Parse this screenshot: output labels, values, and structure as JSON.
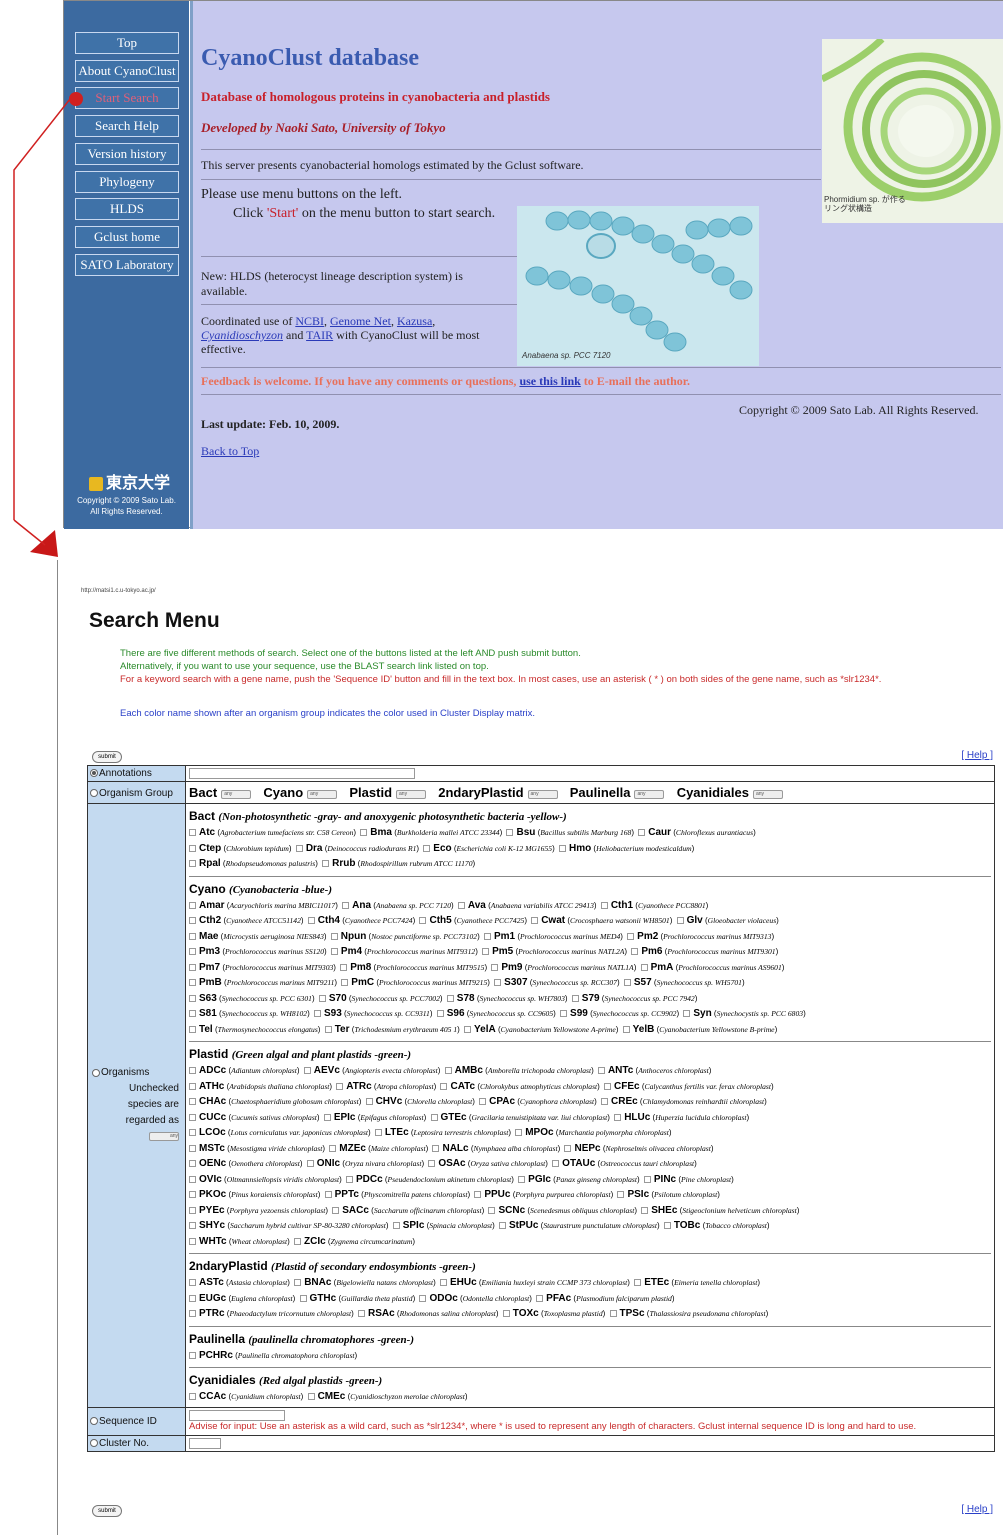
{
  "top": {
    "sidebar_buttons": [
      "Top",
      "About CyanoClust",
      "Start Search",
      "Search Help",
      "Version history",
      "Phylogeny",
      "HLDS",
      "Gclust home",
      "SATO Laboratory"
    ],
    "university_logo": "東京大学",
    "sidebar_copyright": [
      "Copyright © 2009 Sato Lab.",
      "All Rights Reserved."
    ],
    "title": "CyanoClust database",
    "subtitle": "Database of homologous proteins in cyanobacteria and plastids",
    "developer": "Developed by Naoki Sato, University of Tokyo",
    "server_desc": "This server presents cyanobacterial homologs estimated by the Gclust software.",
    "please_use": "Please use  menu buttons on the left.",
    "click_pre": "Click ",
    "click_start": "'Start'",
    "click_post": " on the menu button to start",
    "click_post2": "search.",
    "new_hlds": "New: HLDS (heterocyst lineage description system) is available.",
    "coord_pre": "Coordinated use of ",
    "coord_links": [
      "NCBI",
      "Genome Net",
      "Kazusa",
      "Cyanidioschyzon",
      "TAIR"
    ],
    "coord_post": " with CyanoClust will be most effective.",
    "feedback_pre": "Feedback is welcome. If you have any comments or questions, ",
    "feedback_link": "use this link",
    "feedback_post": " to E-mail the author.",
    "copyright": "Copyright © 2009 Sato Lab. All Rights Reserved.",
    "last_update": "Last update: Feb. 10, 2009.",
    "back_to_top": "Back to Top",
    "photo1_caption": "Phormidium sp. が作る\nリング状構造",
    "photo2_caption": "Anabaena sp. PCC 7120"
  },
  "bottom": {
    "url": "http://matsi1.c.u-tokyo.ac.jp/",
    "title": "Search Menu",
    "intro": [
      {
        "color": "green",
        "text": "There are five different methods of search. Select one of the buttons listed at the left AND push submit button."
      },
      {
        "color": "green",
        "text": "Alternatively, if you want to use your sequence, use the BLAST search link listed on top."
      },
      {
        "color": "red",
        "text": "For a keyword search with a gene name, push the 'Sequence ID' button and fill in the text box. In most cases, use an asterisk ( * ) on both sides of the gene name, such as *slr1234*."
      },
      {
        "color": "blue",
        "text": "Each color name shown after an organism group indicates the color used in Cluster Display matrix."
      }
    ],
    "submit_label": "submit",
    "help_label": "[ Help ]",
    "row_annotations": "Annotations",
    "row_organism_group": "Organism Group",
    "organism_groups": [
      "Bact",
      "Cyano",
      "Plastid",
      "2ndaryPlastid",
      "Paulinella",
      "Cyanidiales"
    ],
    "select_any": "any",
    "row_organisms": "Organisms",
    "unchecked_note": [
      "Unchecked",
      "species are",
      "regarded as"
    ],
    "groups": [
      {
        "name": "Bact",
        "desc": "(Non-photosynthetic -gray- and anoxygenic photosynthetic bacteria -yellow-)",
        "lines": [
          [
            [
              "Atc",
              "Agrobacterium tumefaciens str. C58 Cereon"
            ],
            [
              "Bma",
              "Burkholderia mallei ATCC 23344"
            ],
            [
              "Bsu",
              "Bacillus subtilis Marburg 168"
            ],
            [
              "Caur",
              "Chloroflexus aurantiacus"
            ]
          ],
          [
            [
              "Ctep",
              "Chlorobium tepidum"
            ],
            [
              "Dra",
              "Deinococcus radiodurans R1"
            ],
            [
              "Eco",
              "Escherichia coli K-12 MG1655"
            ],
            [
              "Hmo",
              "Heliobacterium modesticaldum"
            ]
          ],
          [
            [
              "Rpal",
              "Rhodopseudomonas palustris"
            ],
            [
              "Rrub",
              "Rhodospirillum rubrum ATCC 11170"
            ]
          ]
        ]
      },
      {
        "name": "Cyano",
        "desc": "(Cyanobacteria -blue-)",
        "lines": [
          [
            [
              "Amar",
              "Acaryochloris marina MBIC11017"
            ],
            [
              "Ana",
              "Anabaena sp. PCC 7120"
            ],
            [
              "Ava",
              "Anabaena variabilis ATCC 29413"
            ],
            [
              "Cth1",
              "Cyanothece PCC8801"
            ]
          ],
          [
            [
              "Cth2",
              "Cyanothece ATCC51142"
            ],
            [
              "Cth4",
              "Cyanothece PCC7424"
            ],
            [
              "Cth5",
              "Cyanothece PCC7425"
            ],
            [
              "Cwat",
              "Crocosphaera watsonii WH8501"
            ],
            [
              "Glv",
              "Gloeobacter violaceus"
            ]
          ],
          [
            [
              "Mae",
              "Microcystis aeruginosa NIES843"
            ],
            [
              "Npun",
              "Nostoc punctiforme sp. PCC73102"
            ],
            [
              "Pm1",
              "Prochlorococcus marinus MED4"
            ],
            [
              "Pm2",
              "Prochlorococcus marinus MIT9313"
            ]
          ],
          [
            [
              "Pm3",
              "Prochlorococcus marinus SS120"
            ],
            [
              "Pm4",
              "Prochlorococcus marinus MIT9312"
            ],
            [
              "Pm5",
              "Prochlorococcus marinus NATL2A"
            ],
            [
              "Pm6",
              "Prochlorococcus marinus MIT9301"
            ]
          ],
          [
            [
              "Pm7",
              "Prochlorococcus marinus MIT9303"
            ],
            [
              "Pm8",
              "Prochlorococcus marinus MIT9515"
            ],
            [
              "Pm9",
              "Prochlorococcus marinus NATL1A"
            ],
            [
              "PmA",
              "Prochlorococcus marinus AS9601"
            ]
          ],
          [
            [
              "PmB",
              "Prochlorococcus marinus MIT9211"
            ],
            [
              "PmC",
              "Prochlorococcus marinus MIT9215"
            ],
            [
              "S307",
              "Synechococcus sp. RCC307"
            ],
            [
              "S57",
              "Synechococcus sp. WH5701"
            ]
          ],
          [
            [
              "S63",
              "Synechococcus sp. PCC 6301"
            ],
            [
              "S70",
              "Synechococcus sp. PCC7002"
            ],
            [
              "S78",
              "Synechococcus sp. WH7803"
            ],
            [
              "S79",
              "Synechococcus sp. PCC 7942"
            ]
          ],
          [
            [
              "S81",
              "Synechococcus sp. WH8102"
            ],
            [
              "S93",
              "Synechococcus sp. CC9311"
            ],
            [
              "S96",
              "Synechococcus sp. CC9605"
            ],
            [
              "S99",
              "Synechococcus sp. CC9902"
            ],
            [
              "Syn",
              "Synechocystis sp. PCC 6803"
            ]
          ],
          [
            [
              "Tel",
              "Thermosynechococcus elongatus"
            ],
            [
              "Ter",
              "Trichodesmium erythraeum 405 1"
            ],
            [
              "YelA",
              "Cyanobacterium Yellowstone A-prime"
            ],
            [
              "YelB",
              "Cyanobacterium Yellowstone B-prime"
            ]
          ]
        ]
      },
      {
        "name": "Plastid",
        "desc": "(Green algal and plant plastids -green-)",
        "lines": [
          [
            [
              "ADCc",
              "Adiantum chloroplast"
            ],
            [
              "AEVc",
              "Angiopteris evecta chloroplast"
            ],
            [
              "AMBc",
              "Amborella trichopoda chloroplast"
            ],
            [
              "ANTc",
              "Anthoceros chloroplast"
            ]
          ],
          [
            [
              "ATHc",
              "Arabidopsis thaliana chloroplast"
            ],
            [
              "ATRc",
              "Atropa chloroplast"
            ],
            [
              "CATc",
              "Chlorokybus atmophyticus chloroplast"
            ],
            [
              "CFEc",
              "Calycanthus fertilis var. ferax chloroplast"
            ]
          ],
          [
            [
              "CHAc",
              "Chaetosphaeridium globosum chloroplast"
            ],
            [
              "CHVc",
              "Chlorella chloroplast"
            ],
            [
              "CPAc",
              "Cyanophora chloroplast"
            ],
            [
              "CREc",
              "Chlamydomonas reinhardtii chloroplast"
            ]
          ],
          [
            [
              "CUCc",
              "Cucumis sativus chloroplast"
            ],
            [
              "EPIc",
              "Epifagus chloroplast"
            ],
            [
              "GTEc",
              "Gracilaria tenuistipitata var. liui chloroplast"
            ],
            [
              "HLUc",
              "Huperzia lucidula chloroplast"
            ]
          ],
          [
            [
              "LCOc",
              "Lotus corniculatus var. japonicus chloroplast"
            ],
            [
              "LTEc",
              "Leptosira terrestris chloroplast"
            ],
            [
              "MPOc",
              "Marchantia polymorpha chloroplast"
            ]
          ],
          [
            [
              "MSTc",
              "Mesostigma viride chloroplast"
            ],
            [
              "MZEc",
              "Maize chloroplast"
            ],
            [
              "NALc",
              "Nymphaea alba chloroplast"
            ],
            [
              "NEPc",
              "Nephroselmis olivacea chloroplast"
            ]
          ],
          [
            [
              "OENc",
              "Oenothera chloroplast"
            ],
            [
              "ONIc",
              "Oryza nivara chloroplast"
            ],
            [
              "OSAc",
              "Oryza sativa chloroplast"
            ],
            [
              "OTAUc",
              "Ostreococcus tauri chloroplast"
            ]
          ],
          [
            [
              "OVIc",
              "Oltmannsiellopsis viridis chloroplast"
            ],
            [
              "PDCc",
              "Pseudendoclonium akinetum chloroplast"
            ],
            [
              "PGIc",
              "Panax ginseng chloroplast"
            ],
            [
              "PINc",
              "Pine chloroplast"
            ]
          ],
          [
            [
              "PKOc",
              "Pinus koraiensis chloroplast"
            ],
            [
              "PPTc",
              "Physcomitrella patens chloroplast"
            ],
            [
              "PPUc",
              "Porphyra purpurea chloroplast"
            ],
            [
              "PSIc",
              "Psilotum chloroplast"
            ]
          ],
          [
            [
              "PYEc",
              "Porphyra yezoensis chloroplast"
            ],
            [
              "SACc",
              "Saccharum officinarum chloroplast"
            ],
            [
              "SCNc",
              "Scenedesmus obliquus chloroplast"
            ],
            [
              "SHEc",
              "Stigeoclonium helveticum chloroplast"
            ]
          ],
          [
            [
              "SHYc",
              "Saccharum hybrid cultivar SP-80-3280 chloroplast"
            ],
            [
              "SPIc",
              "Spinacia chloroplast"
            ],
            [
              "StPUc",
              "Staurastrum punctulatum chloroplast"
            ],
            [
              "TOBc",
              "Tobacco chloroplast"
            ]
          ],
          [
            [
              "WHTc",
              "Wheat chloroplast"
            ],
            [
              "ZCIc",
              "Zygnema circumcarinatum"
            ]
          ]
        ]
      },
      {
        "name": "2ndaryPlastid",
        "desc": "(Plastid of secondary endosymbionts -green-)",
        "lines": [
          [
            [
              "ASTc",
              "Astasia chloroplast"
            ],
            [
              "BNAc",
              "Bigelowiella natans chloroplast"
            ],
            [
              "EHUc",
              "Emiliania huxleyi strain CCMP 373 chloroplast"
            ],
            [
              "ETEc",
              "Eimeria tenella chloroplast"
            ]
          ],
          [
            [
              "EUGc",
              "Euglena chloroplast"
            ],
            [
              "GTHc",
              "Guillardia theta plastid"
            ],
            [
              "ODOc",
              "Odontella chloroplast"
            ],
            [
              "PFAc",
              "Plasmodium falciparum plastid"
            ]
          ],
          [
            [
              "PTRc",
              "Phaeodactylum tricornutum chloroplast"
            ],
            [
              "RSAc",
              "Rhodomonas salina chloroplast"
            ],
            [
              "TOXc",
              "Toxoplasma plastid"
            ],
            [
              "TPSc",
              "Thalassiosira pseudonana chloroplast"
            ]
          ]
        ]
      },
      {
        "name": "Paulinella",
        "desc": "(paulinella chromatophores -green-)",
        "lines": [
          [
            [
              "PCHRc",
              "Paulinella chromatophora chloroplast"
            ]
          ]
        ]
      },
      {
        "name": "Cyanidiales",
        "desc": "(Red algal plastids -green-)",
        "lines": [
          [
            [
              "CCAc",
              "Cyanidium chloroplast"
            ],
            [
              "CMEc",
              "Cyanidioschyzon merolae chloroplast"
            ]
          ]
        ]
      }
    ],
    "row_sequence_id": "Sequence ID",
    "advise": "Advise for input: Use an asterisk as a wild card, such as *slr1234*, where * is used to represent any length of characters. Gclust internal sequence ID is long and hard to use.",
    "row_cluster_no": "Cluster No."
  },
  "colors": {
    "sidebar": "#3c6aa0",
    "main_bg": "#c6c8ee",
    "title": "#3a5bb0",
    "accent_red": "#c8202a",
    "label_bg": "#c4daf0"
  }
}
